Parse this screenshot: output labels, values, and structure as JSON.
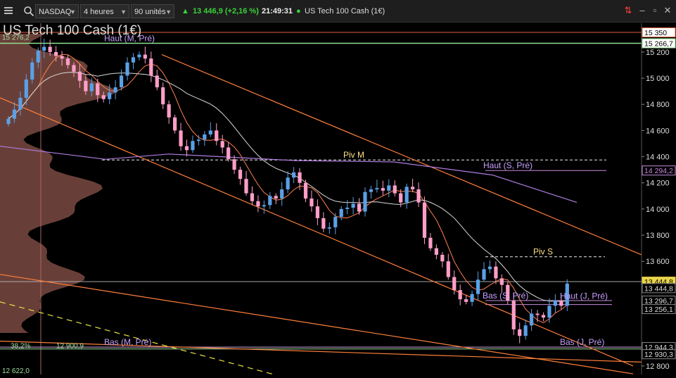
{
  "toolbar": {
    "symbol": "NASDAQ",
    "timeframe": "4 heures",
    "units": "90 unités",
    "price_change": "13 446,9 (+2,16 %)",
    "time": "21:49:31",
    "instrument": "US Tech 100 Cash (1€)"
  },
  "colors": {
    "up_candle": "#5aa0e6",
    "down_candle": "#ff9ec8",
    "ma_fast": "#ff7f50",
    "ma_mid": "#d8d8d8",
    "ma_slow": "#b07ce0",
    "channel": "#ff7f3a",
    "profile": "#7a4a42"
  },
  "chart_data": {
    "type": "candlestick",
    "title": "US Tech 100 Cash (1€)",
    "ylim": [
      12735,
      15420
    ],
    "y_ticks": [
      "15 200",
      "15 000",
      "14 800",
      "14 600",
      "14 400",
      "14 200",
      "14 000",
      "13 800",
      "13 600",
      "12 800"
    ],
    "y_tick_values": [
      15200,
      15000,
      14800,
      14600,
      14400,
      14200,
      14000,
      13800,
      13600,
      12800
    ],
    "price_tags": [
      {
        "label": "15 350",
        "value": 15350,
        "style": "box"
      },
      {
        "label": "15 266,7",
        "value": 15266.7,
        "style": "box-green"
      },
      {
        "label": "14 294,2",
        "value": 14294.2,
        "style": "box-purple"
      },
      {
        "label": "13 444,8",
        "value": 13444.8,
        "style": "box-yellow"
      },
      {
        "label": "13 444,8",
        "value": 13395,
        "style": "box-gray"
      },
      {
        "label": "13 296,7",
        "value": 13300,
        "style": "box-gray"
      },
      {
        "label": "13 256,1",
        "value": 13235,
        "style": "box-gray"
      },
      {
        "label": "12 944,3",
        "value": 12944.3,
        "style": "box-gray"
      },
      {
        "label": "12 930,3",
        "value": 12890,
        "style": "box-gray"
      }
    ],
    "left_labels": [
      {
        "label": "15 276,2",
        "value": 15276.2
      },
      {
        "label": "38,2%",
        "value": 12920
      },
      {
        "label": "12 900,9",
        "value": 12920
      },
      {
        "label": "12 622,0",
        "value": 12730
      }
    ],
    "levels": [
      {
        "label": "Haut (M, Pré)",
        "value": 15266.7
      },
      {
        "label": "Piv M",
        "value": 14375
      },
      {
        "label": "Haut (S, Pré)",
        "value": 14294.2
      },
      {
        "label": "Piv S",
        "value": 13635
      },
      {
        "label": "Bas (S, Pré)",
        "value": 13300
      },
      {
        "label": "Haut (J, Pré)",
        "value": 13296.7
      },
      {
        "label": "Bas (J, Pré)",
        "value": 12944.3
      },
      {
        "label": "Bas (M, Pré)",
        "value": 12944.3
      }
    ],
    "closes": [
      14690,
      14760,
      14850,
      14990,
      15120,
      15210,
      15240,
      15200,
      15170,
      15150,
      15100,
      15050,
      14980,
      14900,
      14960,
      14870,
      14840,
      14890,
      14930,
      15020,
      15120,
      15160,
      15180,
      15150,
      15020,
      14930,
      14800,
      14700,
      14600,
      14480,
      14450,
      14520,
      14530,
      14570,
      14600,
      14520,
      14470,
      14380,
      14300,
      14230,
      14120,
      14060,
      14020,
      14030,
      14100,
      14080,
      14150,
      14240,
      14280,
      14200,
      14080,
      14020,
      13930,
      13850,
      13860,
      13940,
      14000,
      14010,
      14040,
      13980,
      14130,
      14150,
      14160,
      14140,
      14180,
      14120,
      14050,
      14170,
      14150,
      14050,
      13780,
      13700,
      13650,
      13600,
      13480,
      13380,
      13310,
      13290,
      13350,
      13460,
      13540,
      13560,
      13470,
      13420,
      13300,
      13080,
      13030,
      13110,
      13200,
      13190,
      13170,
      13260,
      13300,
      13260,
      13430
    ]
  }
}
